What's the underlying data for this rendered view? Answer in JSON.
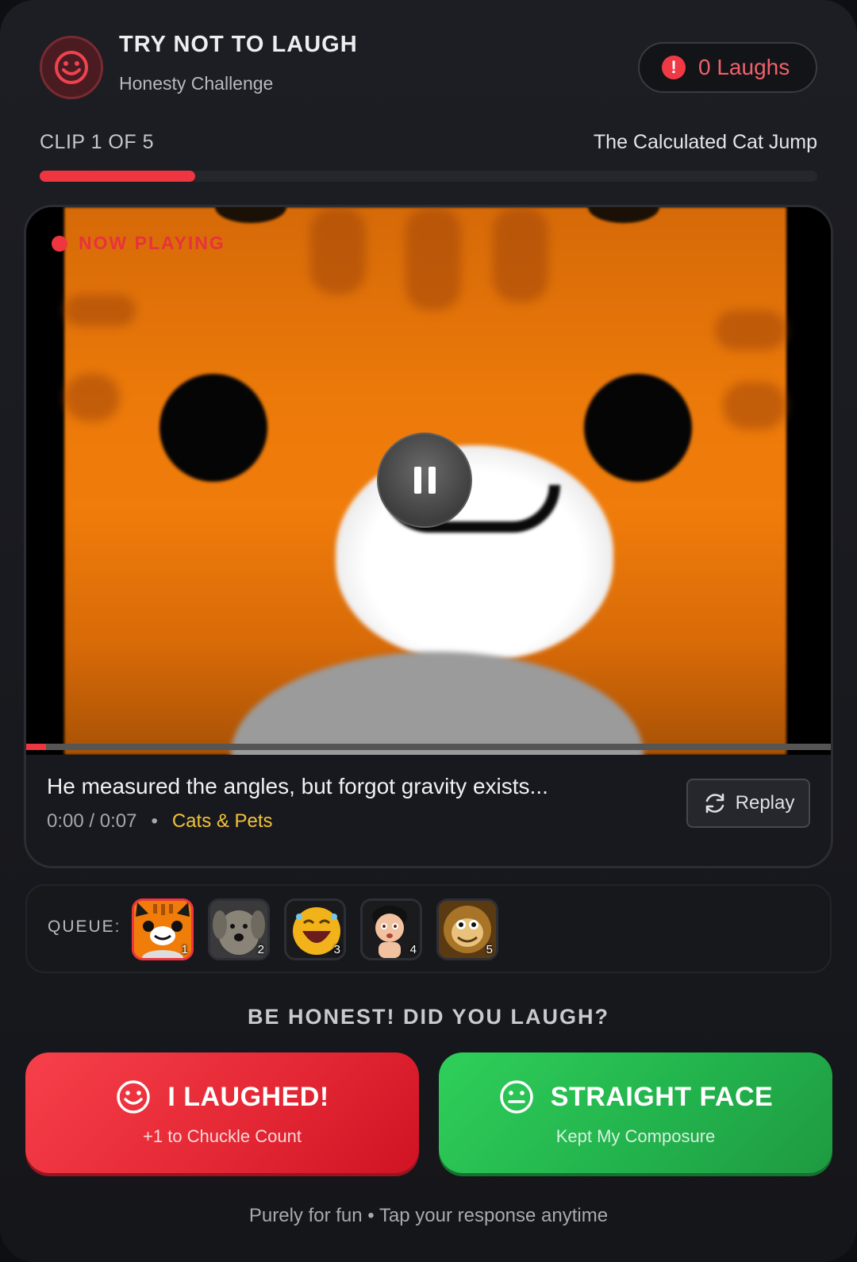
{
  "header": {
    "title": "TRY NOT TO LAUGH",
    "subtitle": "Honesty Challenge",
    "laugh_count_label": "0 Laughs",
    "alert_glyph": "!"
  },
  "clip": {
    "position_label": "CLIP 1 OF 5",
    "title": "The Calculated Cat Jump",
    "progress_fraction": 0.2
  },
  "player": {
    "status_label": "NOW PLAYING",
    "caption": "He measured the angles, but forgot gravity exists...",
    "time_current": "0:00",
    "time_total": "0:07",
    "time_display": "0:00 / 0:07",
    "separator": "•",
    "category": "Cats & Pets",
    "replay_label": "Replay",
    "playback_fraction": 0.025
  },
  "queue": {
    "label": "QUEUE:",
    "items": [
      {
        "num": "1",
        "icon": "cat-thumbnail",
        "active": true
      },
      {
        "num": "2",
        "icon": "dog-thumbnail",
        "active": false
      },
      {
        "num": "3",
        "icon": "laughing-emoji-thumbnail",
        "active": false
      },
      {
        "num": "4",
        "icon": "cartoon-kid-thumbnail",
        "active": false
      },
      {
        "num": "5",
        "icon": "monkey-thumbnail",
        "active": false
      }
    ]
  },
  "prompt": {
    "question": "BE HONEST! DID YOU LAUGH?",
    "laughed": {
      "label": "I LAUGHED!",
      "sub": "+1 to Chuckle Count"
    },
    "straight": {
      "label": "STRAIGHT FACE",
      "sub": "Kept My Composure"
    }
  },
  "footer": {
    "text": "Purely for fun • Tap your response anytime"
  },
  "colors": {
    "accent_red": "#ee3540",
    "accent_green": "#22b14c",
    "category_yellow": "#f2c23a",
    "background": "#1b1c21"
  }
}
